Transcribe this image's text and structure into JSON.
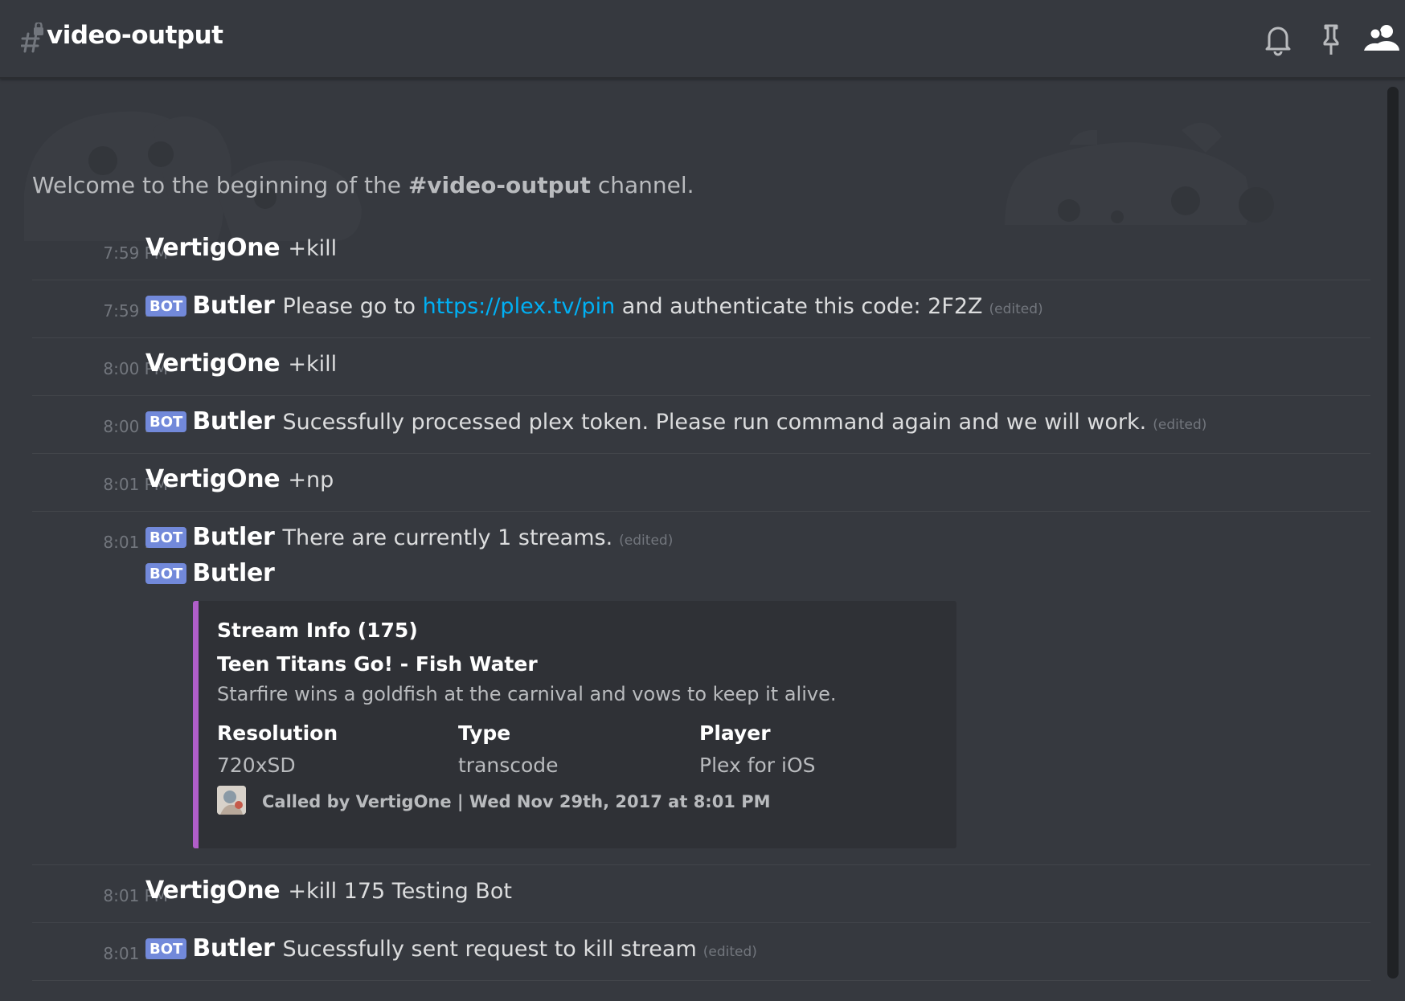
{
  "header": {
    "channel_name": "video-output"
  },
  "welcome": {
    "prefix": "Welcome to the beginning of the ",
    "channel": "#video-output",
    "suffix": " channel."
  },
  "messages": [
    {
      "time": "7:59 PM",
      "user": "VertigOne",
      "bot": false,
      "text": "+kill"
    },
    {
      "time": "7:59 PM",
      "user": "Butler",
      "bot": true,
      "text_before": "Please go to ",
      "link": "https://plex.tv/pin",
      "text_after": " and authenticate this code: 2F2Z",
      "edited": "(edited)"
    },
    {
      "time": "8:00 PM",
      "user": "VertigOne",
      "bot": false,
      "text": "+kill"
    },
    {
      "time": "8:00 PM",
      "user": "Butler",
      "bot": true,
      "text": "Sucessfully processed plex token. Please run command again and we will work.",
      "edited": "(edited)"
    },
    {
      "time": "8:01 PM",
      "user": "VertigOne",
      "bot": false,
      "text": "+np"
    },
    {
      "time": "8:01 PM",
      "user": "Butler",
      "bot": true,
      "text": "There are currently 1 streams.",
      "edited": "(edited)"
    },
    {
      "time": "8:01 PM",
      "user": "VertigOne",
      "bot": false,
      "text": "+kill 175 Testing Bot"
    },
    {
      "time": "8:01 PM",
      "user": "Butler",
      "bot": true,
      "text": "Sucessfully sent request to kill stream",
      "edited": "(edited)"
    }
  ],
  "bot_tag": "BOT",
  "embed_author": "Butler",
  "embed": {
    "title": "Stream Info (175)",
    "subtitle": "Teen Titans Go! - Fish Water",
    "description": "Starfire wins a goldfish at the carnival and vows to keep it alive.",
    "fields": [
      {
        "name": "Resolution",
        "value": "720xSD"
      },
      {
        "name": "Type",
        "value": "transcode"
      },
      {
        "name": "Player",
        "value": "Plex for iOS"
      }
    ],
    "footer": "Called by VertigOne | Wed Nov 29th, 2017 at 8:01 PM",
    "color": "#b05ec9"
  },
  "colors": {
    "background": "#36393f",
    "bot_tag": "#7289da",
    "link": "#00b0f4"
  }
}
